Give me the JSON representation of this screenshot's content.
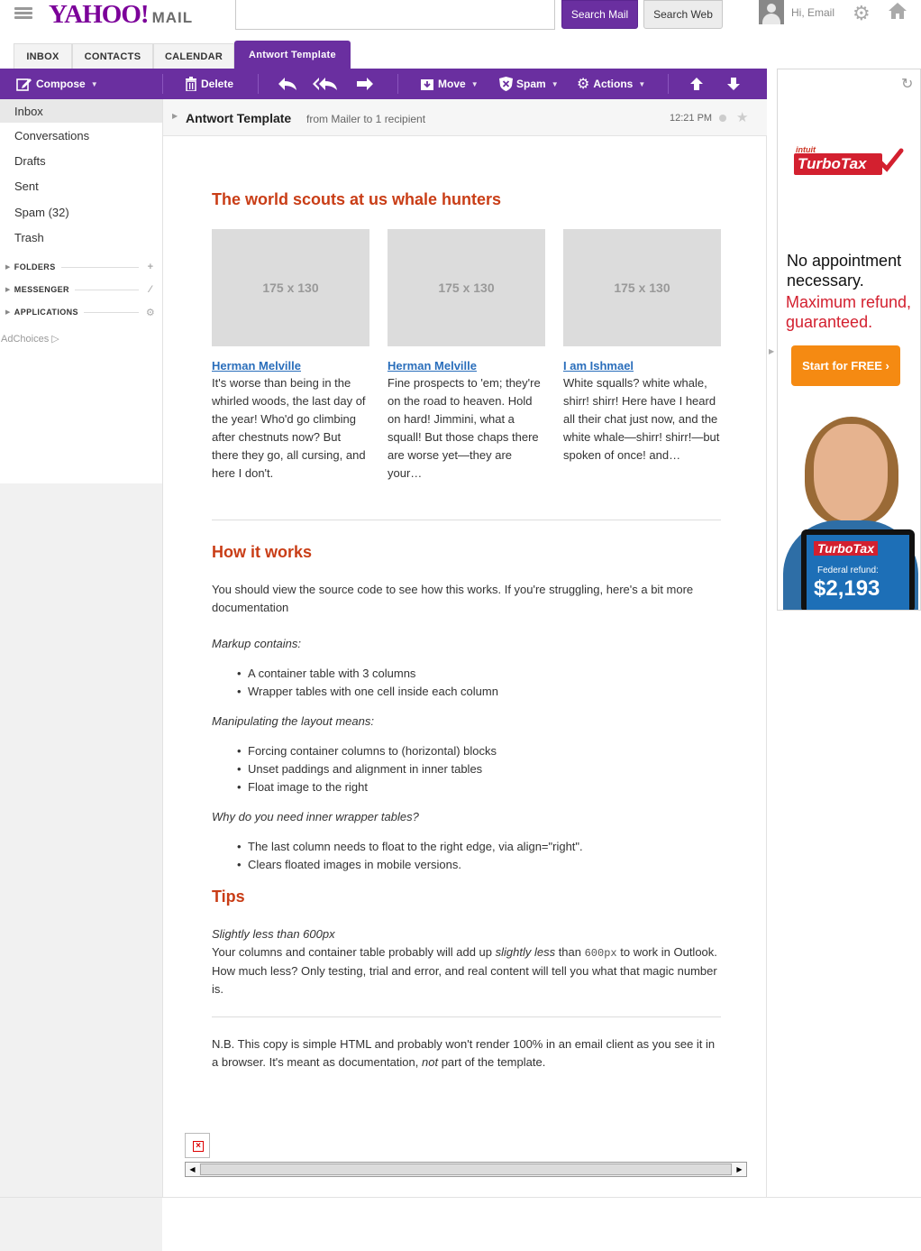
{
  "header": {
    "logo_yahoo": "YAHOO!",
    "logo_mail": "MAIL",
    "search_value": "",
    "search_mail_label": "Search Mail",
    "search_web_label": "Search Web",
    "greeting": "Hi, Email"
  },
  "tabs": [
    {
      "label": "INBOX"
    },
    {
      "label": "CONTACTS"
    },
    {
      "label": "CALENDAR"
    },
    {
      "label": "Antwort Template"
    }
  ],
  "toolbar": {
    "compose": "Compose",
    "delete": "Delete",
    "move": "Move",
    "spam": "Spam",
    "actions": "Actions"
  },
  "sidebar": {
    "items": [
      {
        "label": "Inbox"
      },
      {
        "label": "Conversations"
      },
      {
        "label": "Drafts"
      },
      {
        "label": "Sent"
      },
      {
        "label": "Spam (32)"
      },
      {
        "label": "Trash"
      }
    ],
    "sections": [
      {
        "label": "FOLDERS"
      },
      {
        "label": "MESSENGER"
      },
      {
        "label": "APPLICATIONS"
      }
    ],
    "adchoices": "AdChoices"
  },
  "message": {
    "subject": "Antwort Template",
    "from": "from Mailer to 1 recipient",
    "time": "12:21 PM"
  },
  "email": {
    "heading1": "The world scouts at us whale hunters",
    "columns": [
      {
        "placeholder": "175 x 130",
        "title": "Herman Melville",
        "text": "It's worse than being in the whirled woods, the last day of the year! Who'd go climbing after chestnuts now? But there they go, all cursing, and here I don't."
      },
      {
        "placeholder": "175 x 130",
        "title": "Herman Melville",
        "text": "Fine prospects to 'em; they're on the road to heaven. Hold on hard! Jimmini, what a squall! But those chaps there are worse yet—they are your…"
      },
      {
        "placeholder": "175 x 130",
        "title": "I am Ishmael",
        "text": "White squalls? white whale, shirr! shirr! Here have I heard all their chat just now, and the white whale—shirr! shirr!—but spoken of once! and…"
      }
    ],
    "heading2": "How it works",
    "intro": "You should view the source code to see how this works. If you're struggling, here's a bit more documentation",
    "markup_label": "Markup contains:",
    "markup_items": [
      "A container table with 3 columns",
      "Wrapper tables with one cell inside each column"
    ],
    "layout_label": "Manipulating the layout means:",
    "layout_items": [
      "Forcing container columns to (horizontal) blocks",
      "Unset paddings and alignment in inner tables",
      "Float image to the right"
    ],
    "why_label": "Why do you need inner wrapper tables?",
    "why_items": [
      "The last column needs to float to the right edge, via align=\"right\".",
      "Clears floated images in mobile versions."
    ],
    "heading3": "Tips",
    "tip_label": "Slightly less than 600px",
    "tip_a": "Your columns and container table probably will add up ",
    "tip_em": "slightly less",
    "tip_b": " than ",
    "tip_code": "600px",
    "tip_c": " to work in Outlook. How much less? Only testing, trial and error, and real content will tell you what that magic number is.",
    "nb_a": "N.B. This copy is simple HTML and probably won't render 100% in an email client as you see it in a browser. It's meant as documentation, ",
    "nb_em": "not",
    "nb_b": " part of the template."
  },
  "ad": {
    "brand_small": "intuit",
    "brand": "TurboTax",
    "line1": "No appointment necessary.",
    "line2": "Maximum refund, guaranteed.",
    "cta": "Start for FREE ›",
    "tablet_brand": "TurboTax",
    "tablet_label": "Federal refund:",
    "tablet_amount": "$2,193"
  },
  "colors": {
    "purple": "#6a2fa0",
    "heading_orange": "#c93d16",
    "link_blue": "#2a6ebb"
  }
}
